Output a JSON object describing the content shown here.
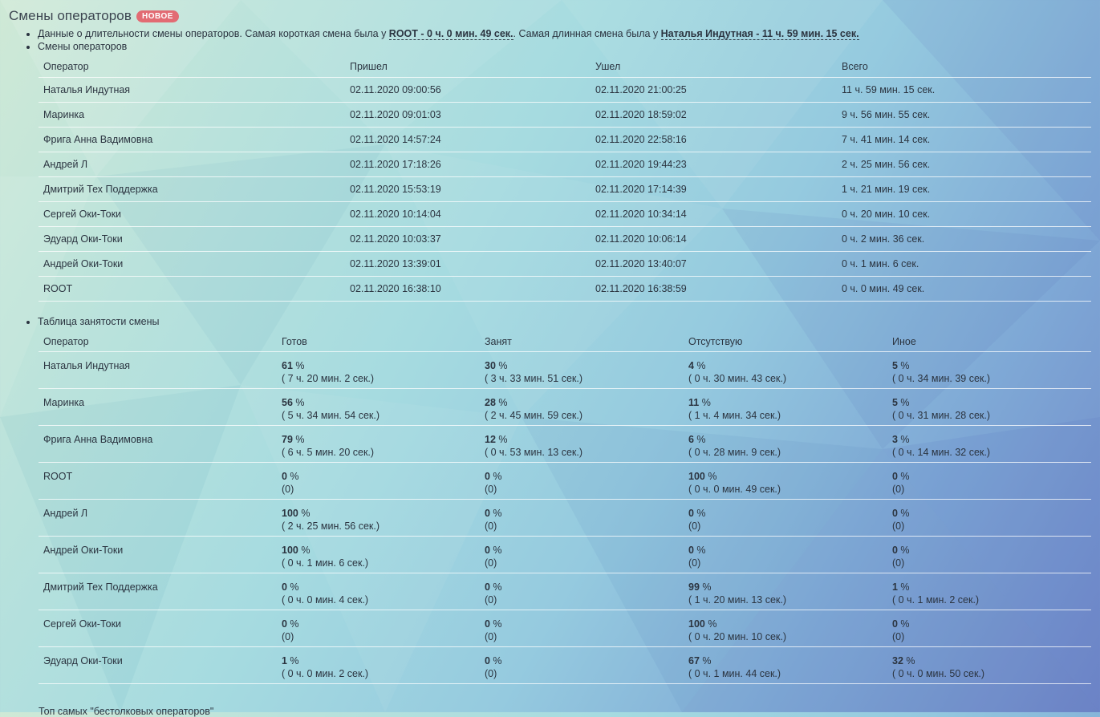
{
  "header": {
    "title": "Смены операторов",
    "badge": "НОВОЕ"
  },
  "summary": {
    "text1": "Данные о длительности смены операторов. Самая короткая смена была у ",
    "shortest": "ROOT - 0 ч. 0 мин. 49 сек.",
    "text2": ". Самая длинная смена была у ",
    "longest": "Наталья Индутная - 11 ч. 59 мин. 15 сек.",
    "shifts_label": "Смены операторов",
    "busy_label": "Таблица занятости смены",
    "next_label": "Топ самых \"бестолковых операторов\""
  },
  "shifts_table": {
    "headers": [
      "Оператор",
      "Пришел",
      "Ушел",
      "Всего"
    ],
    "rows": [
      [
        "Наталья Индутная",
        "02.11.2020 09:00:56",
        "02.11.2020 21:00:25",
        "11 ч. 59 мин. 15 сек."
      ],
      [
        "Маринка",
        "02.11.2020 09:01:03",
        "02.11.2020 18:59:02",
        "9 ч. 56 мин. 55 сек."
      ],
      [
        "Фрига Анна Вадимовна",
        "02.11.2020 14:57:24",
        "02.11.2020 22:58:16",
        "7 ч. 41 мин. 14 сек."
      ],
      [
        "Андрей Л",
        "02.11.2020 17:18:26",
        "02.11.2020 19:44:23",
        "2 ч. 25 мин. 56 сек."
      ],
      [
        "Дмитрий Тех Поддержка",
        "02.11.2020 15:53:19",
        "02.11.2020 17:14:39",
        "1 ч. 21 мин. 19 сек."
      ],
      [
        "Сергей Оки-Токи",
        "02.11.2020 10:14:04",
        "02.11.2020 10:34:14",
        "0 ч. 20 мин. 10 сек."
      ],
      [
        "Эдуард Оки-Токи",
        "02.11.2020 10:03:37",
        "02.11.2020 10:06:14",
        "0 ч. 2 мин. 36 сек."
      ],
      [
        "Андрей Оки-Токи",
        "02.11.2020 13:39:01",
        "02.11.2020 13:40:07",
        "0 ч. 1 мин. 6 сек."
      ],
      [
        "ROOT",
        "02.11.2020 16:38:10",
        "02.11.2020 16:38:59",
        "0 ч. 0 мин. 49 сек."
      ]
    ]
  },
  "busy_table": {
    "headers": [
      "Оператор",
      "Готов",
      "Занят",
      "Отсутствую",
      "Иное"
    ],
    "pct_suffix": " %",
    "rows": [
      {
        "name": "Наталья Индутная",
        "cells": [
          [
            "61",
            "( 7 ч. 20 мин. 2 сек.)"
          ],
          [
            "30",
            "( 3 ч. 33 мин. 51 сек.)"
          ],
          [
            "4",
            "( 0 ч. 30 мин. 43 сек.)"
          ],
          [
            "5",
            "( 0 ч. 34 мин. 39 сек.)"
          ]
        ]
      },
      {
        "name": "Маринка",
        "cells": [
          [
            "56",
            "( 5 ч. 34 мин. 54 сек.)"
          ],
          [
            "28",
            "( 2 ч. 45 мин. 59 сек.)"
          ],
          [
            "11",
            "( 1 ч. 4 мин. 34 сек.)"
          ],
          [
            "5",
            "( 0 ч. 31 мин. 28 сек.)"
          ]
        ]
      },
      {
        "name": "Фрига Анна Вадимовна",
        "cells": [
          [
            "79",
            "( 6 ч. 5 мин. 20 сек.)"
          ],
          [
            "12",
            "( 0 ч. 53 мин. 13 сек.)"
          ],
          [
            "6",
            "( 0 ч. 28 мин. 9 сек.)"
          ],
          [
            "3",
            "( 0 ч. 14 мин. 32 сек.)"
          ]
        ]
      },
      {
        "name": "ROOT",
        "cells": [
          [
            "0",
            "(0)"
          ],
          [
            "0",
            "(0)"
          ],
          [
            "100",
            "( 0 ч. 0 мин. 49 сек.)"
          ],
          [
            "0",
            "(0)"
          ]
        ]
      },
      {
        "name": "Андрей Л",
        "cells": [
          [
            "100",
            "( 2 ч. 25 мин. 56 сек.)"
          ],
          [
            "0",
            "(0)"
          ],
          [
            "0",
            "(0)"
          ],
          [
            "0",
            "(0)"
          ]
        ]
      },
      {
        "name": "Андрей Оки-Токи",
        "cells": [
          [
            "100",
            "( 0 ч. 1 мин. 6 сек.)"
          ],
          [
            "0",
            "(0)"
          ],
          [
            "0",
            "(0)"
          ],
          [
            "0",
            "(0)"
          ]
        ]
      },
      {
        "name": "Дмитрий Тех Поддержка",
        "cells": [
          [
            "0",
            "( 0 ч. 0 мин. 4 сек.)"
          ],
          [
            "0",
            "(0)"
          ],
          [
            "99",
            "( 1 ч. 20 мин. 13 сек.)"
          ],
          [
            "1",
            "( 0 ч. 1 мин. 2 сек.)"
          ]
        ]
      },
      {
        "name": "Сергей Оки-Токи",
        "cells": [
          [
            "0",
            "(0)"
          ],
          [
            "0",
            "(0)"
          ],
          [
            "100",
            "( 0 ч. 20 мин. 10 сек.)"
          ],
          [
            "0",
            "(0)"
          ]
        ]
      },
      {
        "name": "Эдуард Оки-Токи",
        "cells": [
          [
            "1",
            "( 0 ч. 0 мин. 2 сек.)"
          ],
          [
            "0",
            "(0)"
          ],
          [
            "67",
            "( 0 ч. 1 мин. 44 сек.)"
          ],
          [
            "32",
            "( 0 ч. 0 мин. 50 сек.)"
          ]
        ]
      }
    ]
  },
  "colors": {
    "badge": "#e26b73",
    "text": "#2b3440"
  }
}
